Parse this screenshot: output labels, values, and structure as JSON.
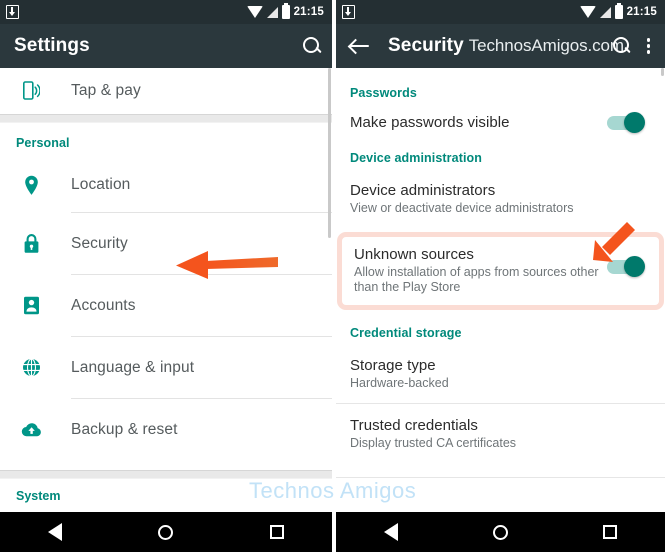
{
  "meta": {
    "accent_teal": "#009688",
    "toolbar_bg": "#2b383d",
    "statusbar_bg": "#242f33",
    "annotation_orange": "#f4541d",
    "highlight_pink": "#fbdcd4",
    "watermark_blue": "#c2e2f7"
  },
  "watermark": {
    "center_text": "Technos Amigos",
    "toolbar_text": "TechnosAmigos.com"
  },
  "left_phone": {
    "statusbar": {
      "download_icon": "download-icon",
      "wifi_icon": "wifi-icon",
      "signal_icon": "signal-icon",
      "battery_icon": "battery-icon",
      "time": "21:15"
    },
    "toolbar": {
      "title": "Settings",
      "search_icon": "search-icon"
    },
    "top_item": {
      "label": "Tap & pay",
      "icon": "nfc-icon"
    },
    "section_label": "Personal",
    "items": [
      {
        "label": "Location",
        "icon": "location-pin-icon"
      },
      {
        "label": "Security",
        "icon": "lock-icon"
      },
      {
        "label": "Accounts",
        "icon": "account-icon"
      },
      {
        "label": "Language & input",
        "icon": "globe-icon"
      },
      {
        "label": "Backup & reset",
        "icon": "cloud-upload-icon"
      }
    ],
    "cut_section_label": "System",
    "navbar": {
      "back": "back-triangle-icon",
      "home": "home-circle-icon",
      "recents": "recents-square-icon"
    }
  },
  "right_phone": {
    "statusbar": {
      "download_icon": "download-icon",
      "wifi_icon": "wifi-icon",
      "signal_icon": "signal-icon",
      "battery_icon": "battery-icon",
      "time": "21:15"
    },
    "toolbar": {
      "back_icon": "back-arrow-icon",
      "title": "Security",
      "search_icon": "search-icon",
      "overflow_icon": "overflow-menu-icon"
    },
    "sections": [
      {
        "header": "Passwords",
        "rows": [
          {
            "title": "Make passwords visible",
            "subtitle": "",
            "toggle": true,
            "toggle_on": true
          }
        ]
      },
      {
        "header": "Device administration",
        "rows": [
          {
            "title": "Device administrators",
            "subtitle": "View or deactivate device administrators",
            "toggle": false
          },
          {
            "title": "Unknown sources",
            "subtitle": "Allow installation of apps from sources other than the Play Store",
            "toggle": true,
            "toggle_on": true,
            "highlighted": true
          }
        ]
      },
      {
        "header": "Credential storage",
        "rows": [
          {
            "title": "Storage type",
            "subtitle": "Hardware-backed",
            "toggle": false
          },
          {
            "title": "Trusted credentials",
            "subtitle": "Display trusted CA certificates",
            "toggle": false
          }
        ]
      }
    ],
    "navbar": {
      "back": "back-triangle-icon",
      "home": "home-circle-icon",
      "recents": "recents-square-icon"
    }
  },
  "annotations": [
    {
      "name": "arrow-pointing-to-security",
      "direction": "left"
    },
    {
      "name": "arrow-pointing-to-unknown-sources",
      "direction": "down-left"
    }
  ]
}
